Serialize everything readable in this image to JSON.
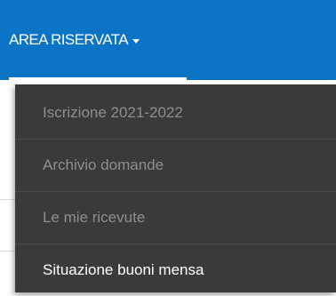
{
  "navbar": {
    "title": "AREA RISERVATA",
    "caret_icon": "caret-down-icon",
    "background_color": "#0b74c4"
  },
  "dropdown": {
    "background_color": "#3a3a3a",
    "items": [
      {
        "label": "Iscrizione 2021-2022"
      },
      {
        "label": "Archivio domande"
      },
      {
        "label": "Le mie ricevute"
      },
      {
        "label": "Situazione buoni mensa"
      }
    ]
  }
}
